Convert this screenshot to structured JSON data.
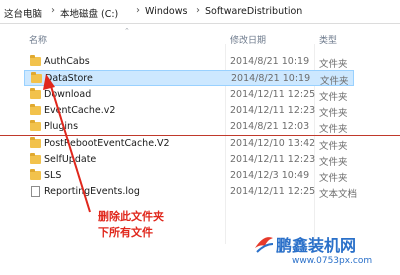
{
  "breadcrumb": [
    "这台电脑",
    "本地磁盘 (C:)",
    "Windows",
    "SoftwareDistribution"
  ],
  "columns": {
    "name": "名称",
    "date": "修改日期",
    "type": "类型"
  },
  "rows": [
    {
      "name": "AuthCabs",
      "date": "2014/8/21 10:19",
      "type": "文件夹",
      "kind": "folder"
    },
    {
      "name": "DataStore",
      "date": "2014/8/21 10:19",
      "type": "文件夹",
      "kind": "folder",
      "selected": true
    },
    {
      "name": "Download",
      "date": "2014/12/11 12:25",
      "type": "文件夹",
      "kind": "folder"
    },
    {
      "name": "EventCache.v2",
      "date": "2014/12/11 12:23",
      "type": "文件夹",
      "kind": "folder"
    },
    {
      "name": "Plugins",
      "date": "2014/8/21 12:03",
      "type": "文件夹",
      "kind": "folder"
    },
    {
      "name": "PostRebootEventCache.V2",
      "date": "2014/12/10 13:42",
      "type": "文件夹",
      "kind": "folder"
    },
    {
      "name": "SelfUpdate",
      "date": "2014/12/11 12:23",
      "type": "文件夹",
      "kind": "folder"
    },
    {
      "name": "SLS",
      "date": "2014/12/3 10:49",
      "type": "文件夹",
      "kind": "folder"
    },
    {
      "name": "ReportingEvents.log",
      "date": "2014/12/11 12:25",
      "type": "文本文档",
      "kind": "file"
    }
  ],
  "annotation": {
    "line1": "删除此文件夹",
    "line2": "下所有文件",
    "color": "#e0271c"
  },
  "watermark": {
    "title": "鹏鑫装机网",
    "url": "www.0753px.com"
  },
  "colors": {
    "selection": "#cde8ff",
    "folder": "#f2c24c",
    "brand": "#2a70c9"
  }
}
